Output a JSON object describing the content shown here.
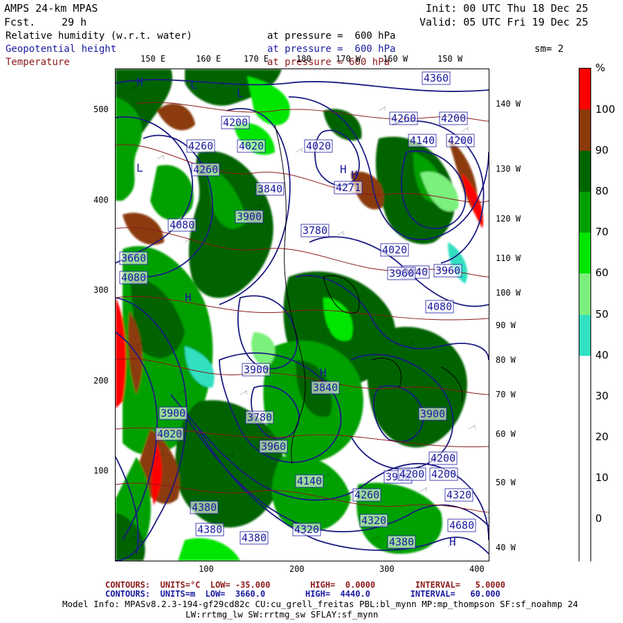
{
  "header": {
    "model": "AMPS 24-km MPAS",
    "fcst_label": "Fcst.",
    "fcst_value": "29 h",
    "init": "Init: 00 UTC Thu 18 Dec 25",
    "valid": "Valid: 05 UTC Fri 19 Dec 25",
    "field1": "Relative humidity (w.r.t. water)",
    "field1_level": "at pressure =  600 hPa",
    "field2": "Geopotential height",
    "field2_level": "at pressure =  600 hPa",
    "field3": "Temperature",
    "field3_level": "at pressure = 600 hPa",
    "smoothing": "sm= 2"
  },
  "axes": {
    "lon_top": [
      "150 E",
      "160 E",
      "170 E",
      "180",
      "170 W",
      "160 W",
      "150 W"
    ],
    "lat_right": [
      "140 W",
      "130 W",
      "120 W",
      "110 W",
      "100 W",
      "90 W",
      "80 W",
      "70 W",
      "60 W",
      "50 W",
      "40 W"
    ],
    "y_left": [
      "500",
      "400",
      "300",
      "200",
      "100"
    ],
    "x_bottom": [
      "100",
      "200",
      "300",
      "400"
    ]
  },
  "colorbar": {
    "unit": "%",
    "labels": [
      "100",
      "90",
      "80",
      "70",
      "60",
      "50",
      "40",
      "30",
      "20",
      "10",
      "0"
    ],
    "colors": [
      "#ff0000",
      "#8b3a0a",
      "#006400",
      "#00a000",
      "#00e600",
      "#7cf07c",
      "#30e0c0",
      "#ffffff",
      "#ffffff",
      "#ffffff",
      "#ffffff",
      "#ffffff"
    ]
  },
  "footer": {
    "temp_contours": "CONTOURS:  UNITS=°C  LOW= -35.000        HIGH=  0.0000        INTERVAL=   5.0000",
    "hgt_contours": "CONTOURS:  UNITS=m  LOW=  3660.0        HIGH=  4440.0        INTERVAL=   60.000",
    "model_info": "Model Info: MPASv8.2.3-194-gf29cd82c CU:cu_grell_freitas PBL:bl_mynn MP:mp_thompson SF:sf_noahmp 24",
    "model_info2": "LW:rrtmg_lw SW:rrtmg_sw SFLAY:sf_mynn"
  },
  "height_labels": [
    "4360",
    "4200",
    "4260",
    "4020",
    "4260",
    "4200",
    "4260",
    "4020",
    "4140",
    "4200",
    "3840",
    "4271",
    "4080",
    "3660",
    "4080",
    "3900",
    "4020",
    "3780",
    "3840",
    "3960",
    "3960",
    "4080",
    "3900",
    "3900",
    "3780",
    "3960",
    "3900",
    "4020",
    "4200",
    "3960",
    "4140",
    "4200",
    "4260",
    "4320",
    "4380",
    "4380",
    "4380",
    "4320",
    "4380",
    "4680",
    "4320",
    "3840",
    "4200"
  ],
  "highs_lows": [
    "H",
    "L",
    "L",
    "H",
    "H",
    "H",
    "L",
    "H",
    "L",
    "H"
  ]
}
